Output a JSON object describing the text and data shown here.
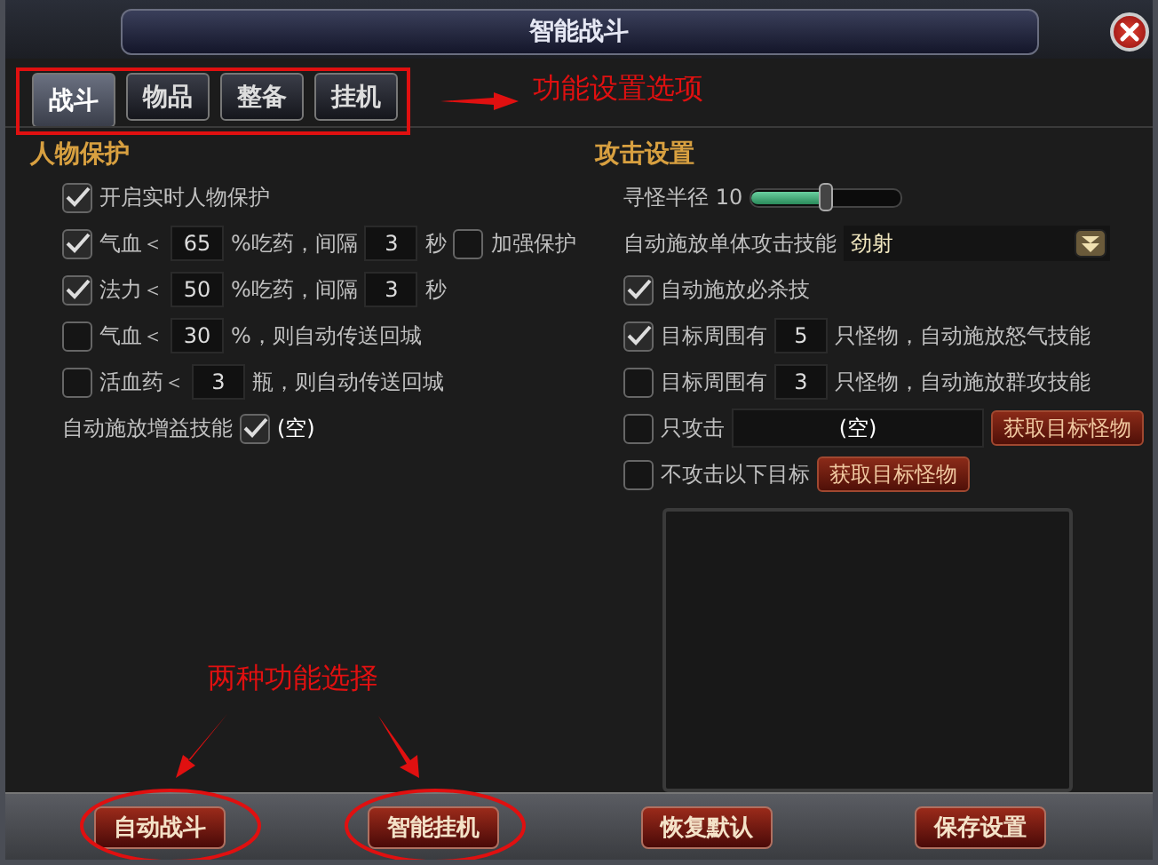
{
  "window": {
    "title": "智能战斗"
  },
  "tabs": [
    {
      "label": "战斗",
      "selected": true
    },
    {
      "label": "物品",
      "selected": false
    },
    {
      "label": "整备",
      "selected": false
    },
    {
      "label": "挂机",
      "selected": false
    }
  ],
  "left_section": {
    "title": "人物保护",
    "rows": [
      {
        "parts": [
          {
            "kind": "checkbox",
            "checked": true
          },
          {
            "kind": "text",
            "text": "开启实时人物保护"
          }
        ]
      },
      {
        "parts": [
          {
            "kind": "checkbox",
            "checked": true
          },
          {
            "kind": "text",
            "text": "气血＜"
          },
          {
            "kind": "input",
            "value": "65"
          },
          {
            "kind": "text",
            "text": "%吃药，间隔"
          },
          {
            "kind": "input",
            "value": "3"
          },
          {
            "kind": "text",
            "text": "秒"
          },
          {
            "kind": "checkbox",
            "checked": false
          },
          {
            "kind": "text",
            "text": "加强保护"
          }
        ]
      },
      {
        "parts": [
          {
            "kind": "checkbox",
            "checked": true
          },
          {
            "kind": "text",
            "text": "法力＜"
          },
          {
            "kind": "input",
            "value": "50"
          },
          {
            "kind": "text",
            "text": "%吃药，间隔"
          },
          {
            "kind": "input",
            "value": "3"
          },
          {
            "kind": "text",
            "text": "秒"
          }
        ]
      },
      {
        "parts": [
          {
            "kind": "checkbox",
            "checked": false
          },
          {
            "kind": "text",
            "text": "气血＜"
          },
          {
            "kind": "input",
            "value": "30"
          },
          {
            "kind": "text",
            "text": "%，则自动传送回城"
          }
        ]
      },
      {
        "parts": [
          {
            "kind": "checkbox",
            "checked": false
          },
          {
            "kind": "text",
            "text": "活血药＜"
          },
          {
            "kind": "input",
            "value": "3"
          },
          {
            "kind": "text",
            "text": "瓶，则自动传送回城"
          }
        ]
      },
      {
        "parts": [
          {
            "kind": "text",
            "text": "自动施放增益技能"
          },
          {
            "kind": "checkbox",
            "checked": true
          },
          {
            "kind": "slot",
            "text": "(空)"
          }
        ]
      }
    ]
  },
  "right_section": {
    "title": "攻击设置",
    "rows": [
      {
        "parts": [
          {
            "kind": "text",
            "text": "寻怪半径 10"
          },
          {
            "kind": "slider",
            "level": 0.5
          }
        ]
      },
      {
        "parts": [
          {
            "kind": "text",
            "text": "自动施放单体攻击技能"
          },
          {
            "kind": "select",
            "value": "劲射"
          }
        ]
      },
      {
        "parts": [
          {
            "kind": "checkbox",
            "checked": true
          },
          {
            "kind": "text",
            "text": "自动施放必杀技"
          }
        ]
      },
      {
        "parts": [
          {
            "kind": "checkbox",
            "checked": true
          },
          {
            "kind": "text",
            "text": "目标周围有"
          },
          {
            "kind": "input",
            "value": "5"
          },
          {
            "kind": "text",
            "text": "只怪物，自动施放怒气技能"
          }
        ]
      },
      {
        "parts": [
          {
            "kind": "checkbox",
            "checked": false
          },
          {
            "kind": "text",
            "text": "目标周围有"
          },
          {
            "kind": "input",
            "value": "3"
          },
          {
            "kind": "text",
            "text": "只怪物，自动施放群攻技能"
          }
        ]
      },
      {
        "parts": [
          {
            "kind": "checkbox",
            "checked": false
          },
          {
            "kind": "text",
            "text": "只攻击"
          },
          {
            "kind": "field",
            "value": "(空)"
          },
          {
            "kind": "button",
            "text": "获取目标怪物"
          }
        ]
      },
      {
        "parts": [
          {
            "kind": "checkbox",
            "checked": false
          },
          {
            "kind": "text",
            "text": "不攻击以下目标"
          },
          {
            "kind": "button",
            "text": "获取目标怪物"
          }
        ]
      }
    ]
  },
  "buttons": [
    "自动战斗",
    "智能挂机",
    "恢复默认",
    "保存设置"
  ],
  "annotations": {
    "tabs_note": "功能设置选项",
    "buttons_note": "两种功能选择"
  }
}
